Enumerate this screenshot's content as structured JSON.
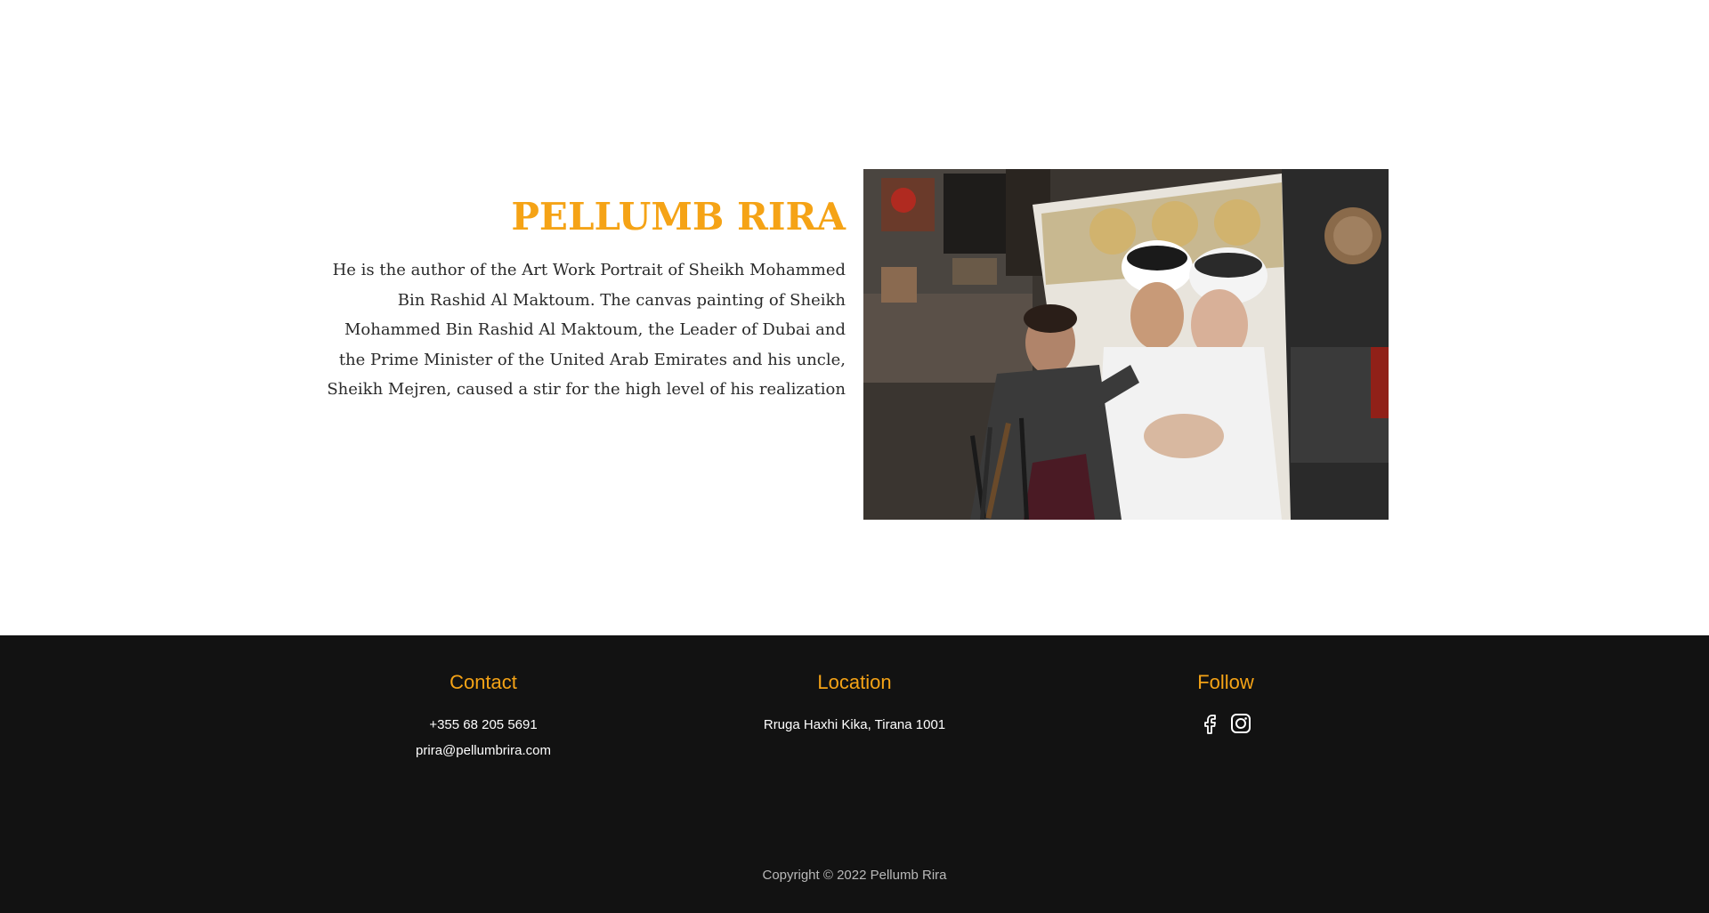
{
  "hero": {
    "title": "PELLUMB RIRA",
    "bio": "He is the author of the Art Work Portrait of Sheikh Mohammed Bin Rashid Al Maktoum. The canvas painting of Sheikh Mohammed Bin Rashid Al Maktoum,  the Leader of Dubai and the Prime Minister of the United Arab Emirates and his uncle, Sheikh Mejren, caused a stir for the high level of his realization",
    "photo_icon": "artist-painting-portrait-photo"
  },
  "footer": {
    "contact": {
      "heading": "Contact",
      "phone": "+355 68 205 5691",
      "email": "prira@pellumbrira.com"
    },
    "location": {
      "heading": "Location",
      "address": "Rruga Haxhi Kika, Tirana 1001"
    },
    "follow": {
      "heading": "Follow",
      "icons": [
        "facebook-icon",
        "instagram-icon"
      ]
    },
    "copyright": "Copyright © 2022 Pellumb Rira"
  },
  "colors": {
    "accent": "#f5a316",
    "footer_bg": "#121212",
    "text": "#2a2a2a"
  }
}
